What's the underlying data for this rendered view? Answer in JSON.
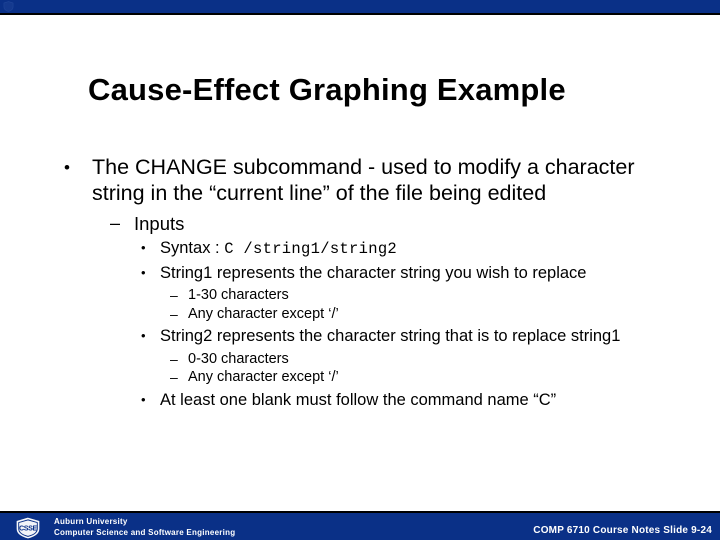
{
  "theme": {
    "bar_color": "#0A3087",
    "bar_border": "#000000",
    "text_color": "#000000",
    "footer_text_color": "#FFFFFF",
    "background": "#FFFFFF"
  },
  "title": "Cause-Effect Graphing Example",
  "body": {
    "bullet_glyph_level1": "•",
    "bullet_glyph_level2": "–",
    "bullet_glyph_level3": "•",
    "bullet_glyph_level4": "–",
    "level1": "The CHANGE subcommand - used to modify a character string in the “current line” of the file being edited",
    "level2_inputs": "Inputs",
    "syntax_label": "Syntax : ",
    "syntax_code": "C /string1/string2",
    "string1_desc": "String1 represents the character string you wish to replace",
    "string1_len": "1-30 characters",
    "string1_rule": "Any character except ‘/’",
    "string2_desc": "String2 represents the character string  that is to replace string1",
    "string2_len": "0-30 characters",
    "string2_rule": "Any character except ‘/’",
    "blank_rule": "At least one blank must follow the command name “C”"
  },
  "footer": {
    "logo_text": "CSSE",
    "org_line1": "Auburn University",
    "org_line2": "Computer Science and Software Engineering",
    "course_note": "COMP 6710 Course Notes Slide 9-24"
  }
}
